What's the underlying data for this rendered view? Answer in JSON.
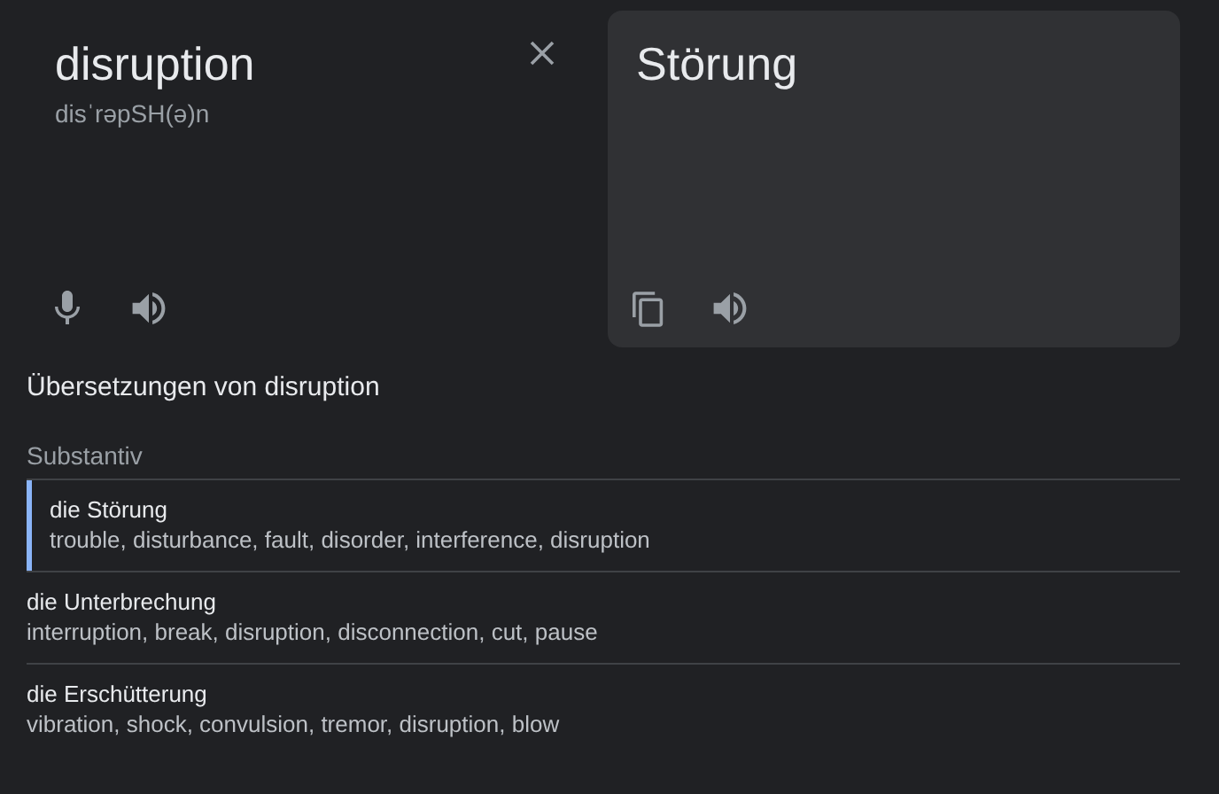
{
  "source": {
    "text": "disruption",
    "phonetic": "disˈrəpSH(ə)n"
  },
  "target": {
    "text": "Störung"
  },
  "translations": {
    "heading": "Übersetzungen von disruption",
    "part_of_speech": "Substantiv",
    "entries": [
      {
        "term": "die Störung",
        "synonyms": "trouble, disturbance, fault, disorder, interference, disruption",
        "selected": true
      },
      {
        "term": "die Unterbrechung",
        "synonyms": "interruption, break, disruption, disconnection, cut, pause",
        "selected": false
      },
      {
        "term": "die Erschütterung",
        "synonyms": "vibration, shock, convulsion, tremor, disruption, blow",
        "selected": false
      }
    ]
  }
}
